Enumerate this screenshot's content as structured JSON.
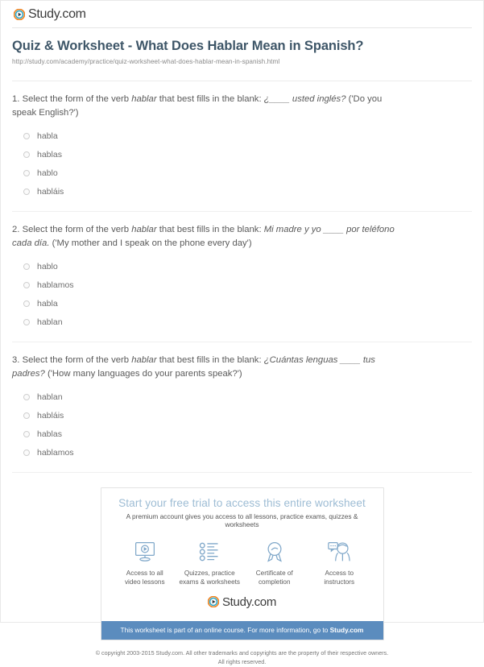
{
  "brand": {
    "name_main": "Study",
    "name_tld": ".com",
    "icon": "play-circle-icon"
  },
  "header": {
    "title": "Quiz & Worksheet - What Does Hablar Mean in Spanish?",
    "url": "http://study.com/academy/practice/quiz-worksheet-what-does-hablar-mean-in-spanish.html"
  },
  "questions": [
    {
      "number": "1.",
      "lead": "Select the form of the verb ",
      "verb": "hablar",
      "mid": " that best fills in the blank: ",
      "prompt": "¿____ usted inglés?",
      "translation": " ('Do you speak English?')",
      "options": [
        "habla",
        "hablas",
        "hablo",
        "habláis"
      ]
    },
    {
      "number": "2.",
      "lead": "Select the form of the verb ",
      "verb": "hablar",
      "mid": " that best fills in the blank: ",
      "prompt": "Mi madre y yo ____ por teléfono cada día.",
      "translation": " ('My mother and I speak on the phone every day')",
      "options": [
        "hablo",
        "hablamos",
        "habla",
        "hablan"
      ]
    },
    {
      "number": "3.",
      "lead": "Select the form of the verb ",
      "verb": "hablar",
      "mid": " that best fills in the blank: ",
      "prompt": "¿Cuántas lenguas ____ tus padres?",
      "translation": " ('How many languages do your parents speak?')",
      "options": [
        "hablan",
        "habláis",
        "hablas",
        "hablamos"
      ]
    }
  ],
  "promo": {
    "title": "Start your free trial to access this entire worksheet",
    "subtitle": "A premium account gives you access to all lessons, practice exams, quizzes & worksheets",
    "features": [
      {
        "icon": "monitor-play-icon",
        "line1": "Access to all",
        "line2": "video lessons"
      },
      {
        "icon": "checklist-icon",
        "line1": "Quizzes, practice",
        "line2": "exams & worksheets"
      },
      {
        "icon": "award-ribbon-icon",
        "line1": "Certificate of",
        "line2": "completion"
      },
      {
        "icon": "instructor-chat-icon",
        "line1": "Access to",
        "line2": "instructors"
      }
    ],
    "banner_prefix": "This worksheet is part of an online course. For more information, go to ",
    "banner_link": "Study.com"
  },
  "footer": {
    "line1": "© copyright 2003-2015 Study.com. All other trademarks and copyrights are the property of their respective owners.",
    "line2": "All rights reserved."
  },
  "colors": {
    "title": "#3e5668",
    "promo_title": "#9dbcd4",
    "banner": "#5b8cbe",
    "icon_line": "#7fa7c9",
    "logo_ring_outer": "#f0801a",
    "logo_ring_inner": "#2ba6c8"
  }
}
